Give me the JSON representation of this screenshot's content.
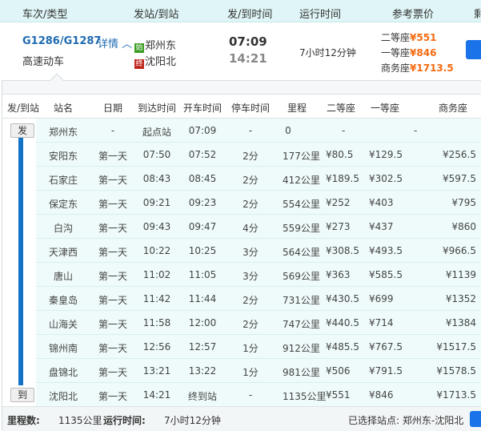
{
  "header": {
    "cols": [
      "车次/类型",
      "发站/到站",
      "发/到时间",
      "运行时间",
      "参考票价",
      "剩"
    ]
  },
  "train": {
    "code": "G1286/G1287",
    "detail_link": "详情",
    "type": "高速动车",
    "from_badge": "始",
    "from": "郑州东",
    "to_badge": "终",
    "to": "沈阳北",
    "depart": "07:09",
    "arrive": "14:21",
    "duration": "7小时12分钟",
    "prices": [
      {
        "seat": "二等座",
        "price": "¥551"
      },
      {
        "seat": "一等座",
        "price": "¥846"
      },
      {
        "seat": "商务座",
        "price": "¥1713.5"
      }
    ]
  },
  "detail": {
    "columns": [
      "发/到站",
      "站名",
      "日期",
      "到达时间",
      "开车时间",
      "停车时间",
      "里程",
      "二等座",
      "一等座",
      "商务座"
    ],
    "depart_tag": "发",
    "arrive_tag": "到",
    "rows": [
      [
        "郑州东",
        "-",
        "起点站",
        "07:09",
        "-",
        "0",
        "-",
        "-",
        "-"
      ],
      [
        "安阳东",
        "第一天",
        "07:50",
        "07:52",
        "2分",
        "177公里",
        "¥80.5",
        "¥129.5",
        "¥256.5"
      ],
      [
        "石家庄",
        "第一天",
        "08:43",
        "08:45",
        "2分",
        "412公里",
        "¥189.5",
        "¥302.5",
        "¥597.5"
      ],
      [
        "保定东",
        "第一天",
        "09:21",
        "09:23",
        "2分",
        "554公里",
        "¥252",
        "¥403",
        "¥795"
      ],
      [
        "白沟",
        "第一天",
        "09:43",
        "09:47",
        "4分",
        "559公里",
        "¥273",
        "¥437",
        "¥860"
      ],
      [
        "天津西",
        "第一天",
        "10:22",
        "10:25",
        "3分",
        "564公里",
        "¥308.5",
        "¥493.5",
        "¥966.5"
      ],
      [
        "唐山",
        "第一天",
        "11:02",
        "11:05",
        "3分",
        "569公里",
        "¥363",
        "¥585.5",
        "¥1139"
      ],
      [
        "秦皇岛",
        "第一天",
        "11:42",
        "11:44",
        "2分",
        "731公里",
        "¥430.5",
        "¥699",
        "¥1352"
      ],
      [
        "山海关",
        "第一天",
        "11:58",
        "12:00",
        "2分",
        "747公里",
        "¥440.5",
        "¥714",
        "¥1384"
      ],
      [
        "锦州南",
        "第一天",
        "12:56",
        "12:57",
        "1分",
        "912公里",
        "¥485.5",
        "¥767.5",
        "¥1517.5"
      ],
      [
        "盘锦北",
        "第一天",
        "13:21",
        "13:22",
        "1分",
        "981公里",
        "¥506",
        "¥791.5",
        "¥1578.5"
      ],
      [
        "沈阳北",
        "第一天",
        "14:21",
        "终到站",
        "-",
        "1135公里",
        "¥551",
        "¥846",
        "¥1713.5"
      ]
    ]
  },
  "footer": {
    "distance_label": "里程数:",
    "distance": "1135公里",
    "duration_label": "运行时间:",
    "duration": "7小时12分钟",
    "selected": "已选择站点: 郑州东-沈阳北"
  },
  "colors": {
    "link": "#1e6ab0",
    "price": "#f46a12",
    "accent": "#1473c6"
  }
}
